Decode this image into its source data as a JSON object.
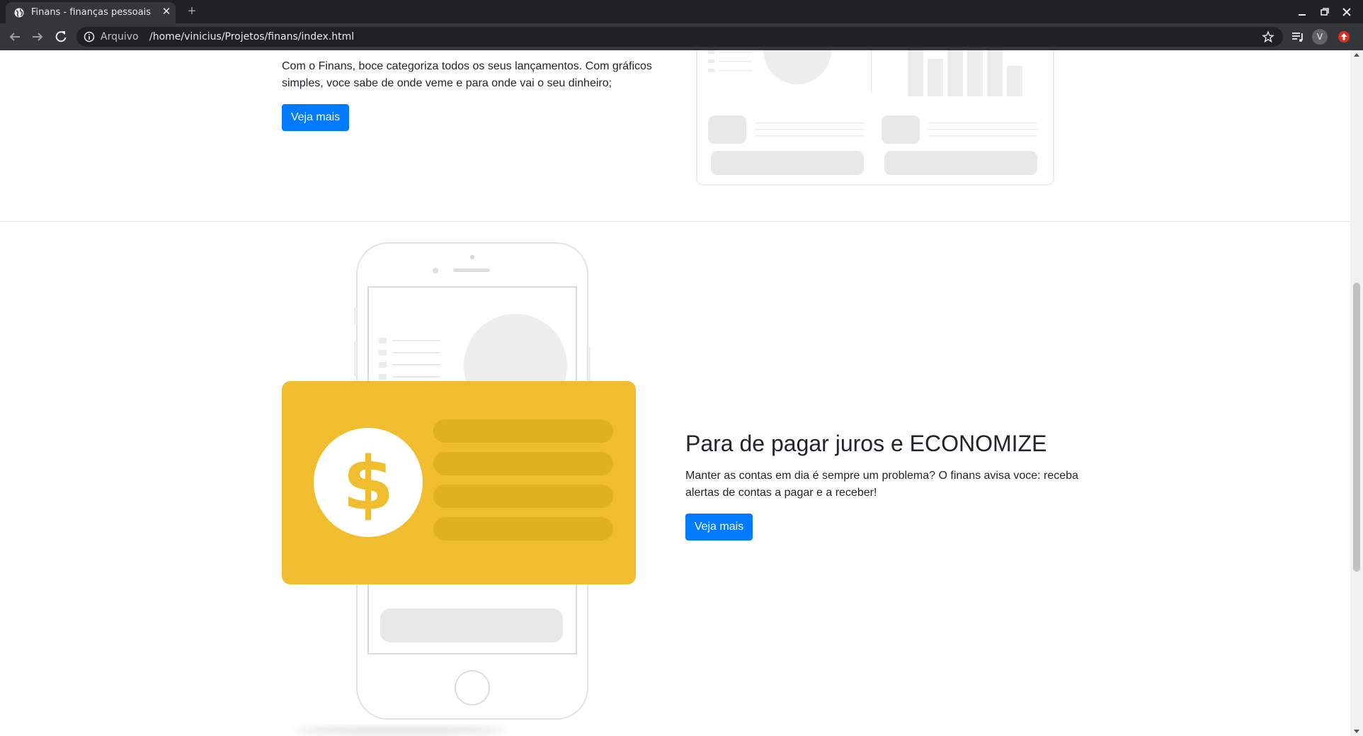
{
  "browser": {
    "tab_title": "Finans - finanças pessoais",
    "scheme_label": "Arquivo",
    "url": "/home/vinicius/Projetos/finans/index.html",
    "profile_initial": "V"
  },
  "section1": {
    "text": "Com o Finans, boce categoriza todos os seus lançamentos. Com gráficos simples, voce sabe de onde veme e para onde vai o seu dinheiro;",
    "button_label": "Veja mais"
  },
  "section2": {
    "heading": "Para de pagar juros e ECONOMIZE",
    "text": "Manter as contas em dia é sempre um problema? O finans avisa voce: receba alertas de contas a pagar e a receber!",
    "button_label": "Veja mais"
  },
  "illustration": {
    "dollar_symbol": "$"
  },
  "colors": {
    "primary": "#007bff",
    "card_yellow": "#f0bd2f",
    "card_stripes": "#e0b021",
    "chrome_dark": "#202124"
  }
}
